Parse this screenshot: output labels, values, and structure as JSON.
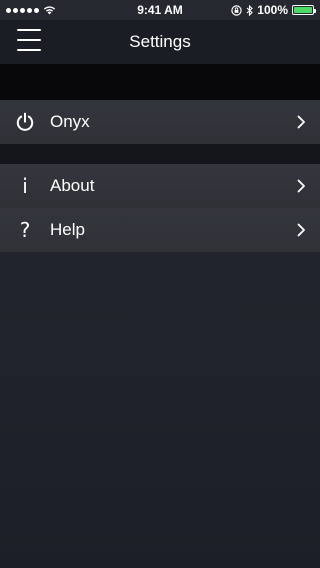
{
  "status_bar": {
    "time": "9:41 AM",
    "battery_percent": "100%",
    "battery_level": 1.0,
    "signal_dots": 5,
    "battery_color": "#4cd964"
  },
  "nav": {
    "title": "Settings",
    "menu_icon": "hamburger-menu-icon"
  },
  "sections": [
    {
      "items": [
        {
          "label": "Onyx",
          "icon": "power-icon"
        }
      ]
    },
    {
      "items": [
        {
          "label": "About",
          "icon": "info-icon",
          "glyph": "i"
        },
        {
          "label": "Help",
          "icon": "question-icon",
          "glyph": "?"
        }
      ]
    }
  ]
}
